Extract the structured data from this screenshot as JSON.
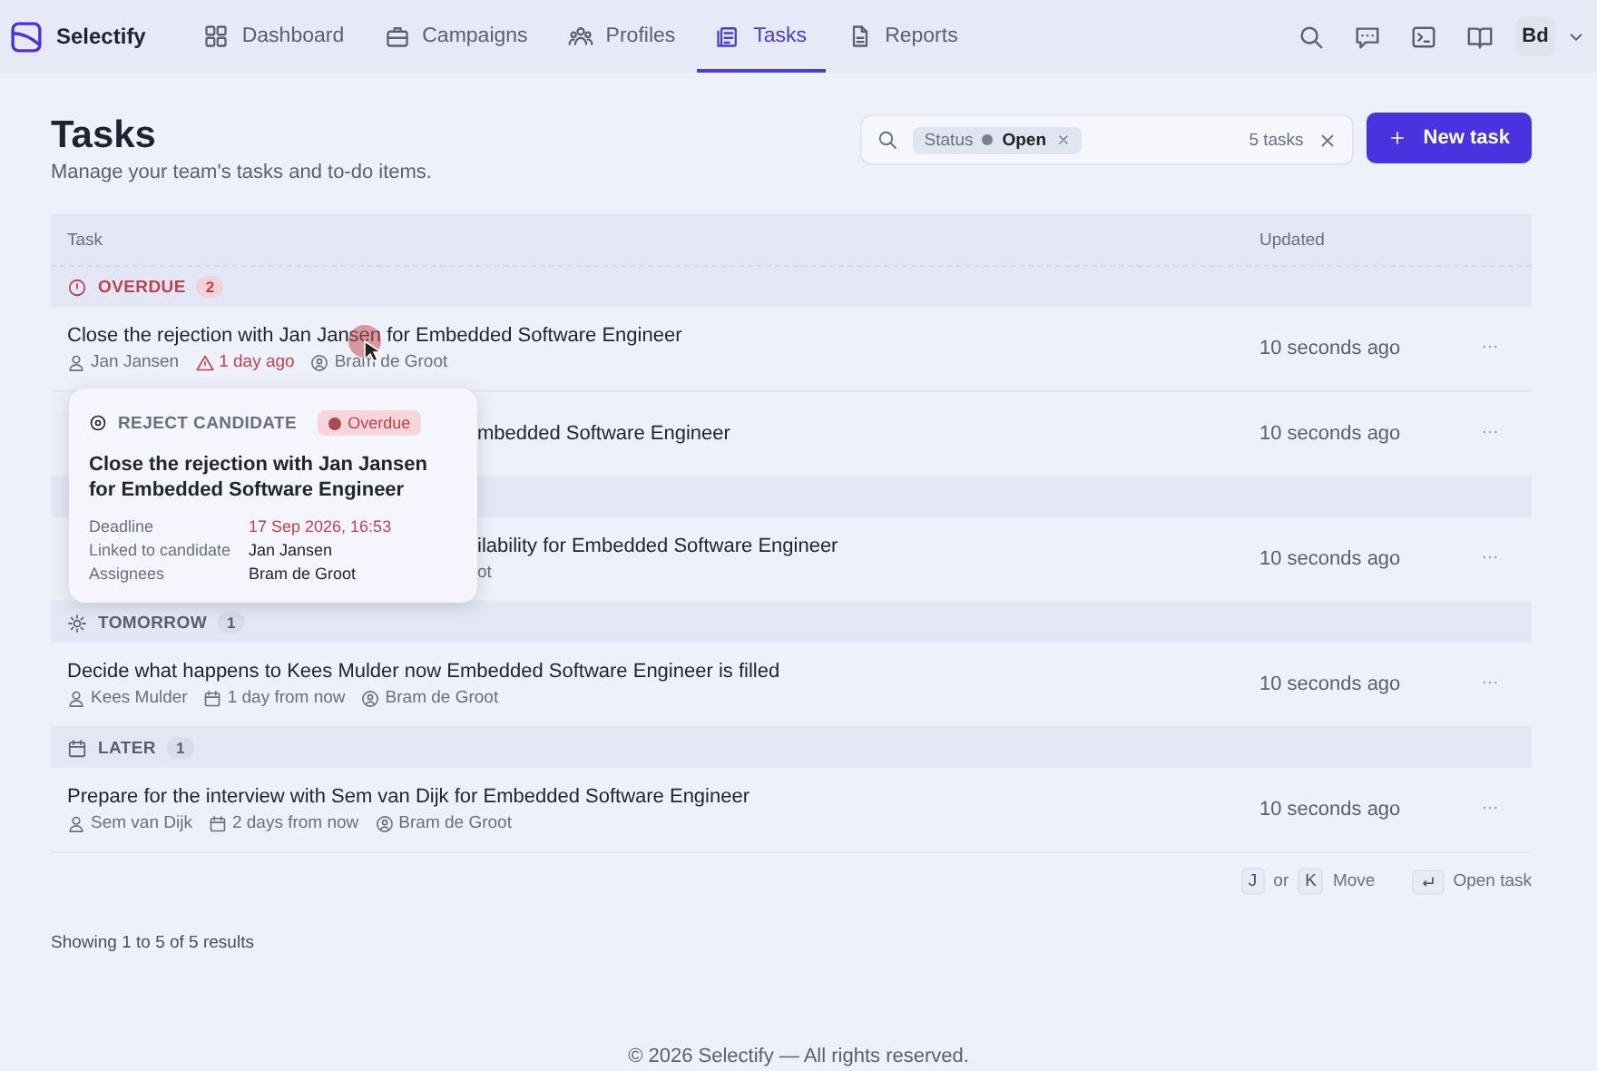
{
  "nav": {
    "brand": "Selectify",
    "items": [
      {
        "label": "Dashboard",
        "selected": false
      },
      {
        "label": "Campaigns",
        "selected": false
      },
      {
        "label": "Profiles",
        "selected": false
      },
      {
        "label": "Tasks",
        "selected": true
      },
      {
        "label": "Reports",
        "selected": false
      }
    ],
    "avatar": "Bd"
  },
  "header": {
    "title": "Tasks",
    "subtitle": "Manage your team's tasks and to-do items."
  },
  "search": {
    "chip_label": "Status",
    "chip_value": "Open",
    "count": "5 tasks"
  },
  "new_button": "New task",
  "table": {
    "columns": [
      "Task",
      "Updated"
    ],
    "groups": [
      {
        "kind": "overdue",
        "label": "OVERDUE",
        "count": "2",
        "rows": [
          {
            "kind": "full",
            "title": "Close the rejection with Jan Jansen for Embedded Software Engineer",
            "candidate": "Jan Jansen",
            "due": "1 day ago",
            "due_overdue": true,
            "assignee": "Bram de Groot",
            "updated": "10 seconds ago"
          },
          {
            "kind": "partly_hidden",
            "title": "mbedded Software Engineer",
            "updated": "10 seconds ago"
          }
        ]
      },
      {
        "kind": "hidden",
        "rows": [
          {
            "kind": "partly_hidden",
            "title": "ilability for Embedded Software Engineer",
            "meta": "ot",
            "updated": "10 seconds ago"
          }
        ]
      },
      {
        "kind": "tomorrow",
        "label": "TOMORROW",
        "count": "1",
        "rows": [
          {
            "kind": "full",
            "title": "Decide what happens to Kees Mulder now Embedded Software Engineer is filled",
            "candidate": "Kees Mulder",
            "due": "1 day from now",
            "due_overdue": false,
            "assignee": "Bram de Groot",
            "updated": "10 seconds ago"
          }
        ]
      },
      {
        "kind": "later",
        "label": "LATER",
        "count": "1",
        "rows": [
          {
            "kind": "full",
            "title": "Prepare for the interview with Sem van Dijk for Embedded Software Engineer",
            "candidate": "Sem van Dijk",
            "due": "2 days from now",
            "due_overdue": false,
            "assignee": "Bram de Groot",
            "updated": "10 seconds ago"
          }
        ]
      }
    ]
  },
  "popover": {
    "type": "REJECT CANDIDATE",
    "badge": "Overdue",
    "title": "Close the rejection with Jan Jansen for Embedded Software Engineer",
    "fields": [
      {
        "label": "Deadline",
        "value": "17 Sep 2026, 16:53",
        "overdue": true
      },
      {
        "label": "Linked to candidate",
        "value": "Jan Jansen",
        "overdue": false
      },
      {
        "label": "Assignees",
        "value": "Bram de Groot",
        "overdue": false
      }
    ]
  },
  "shortcuts": {
    "keys": [
      "J",
      "K"
    ],
    "separator": "or",
    "move": "Move",
    "open": "Open task"
  },
  "results": "Showing 1 to 5 of 5 results",
  "footer": "© 2026 Selectify — All rights reserved."
}
